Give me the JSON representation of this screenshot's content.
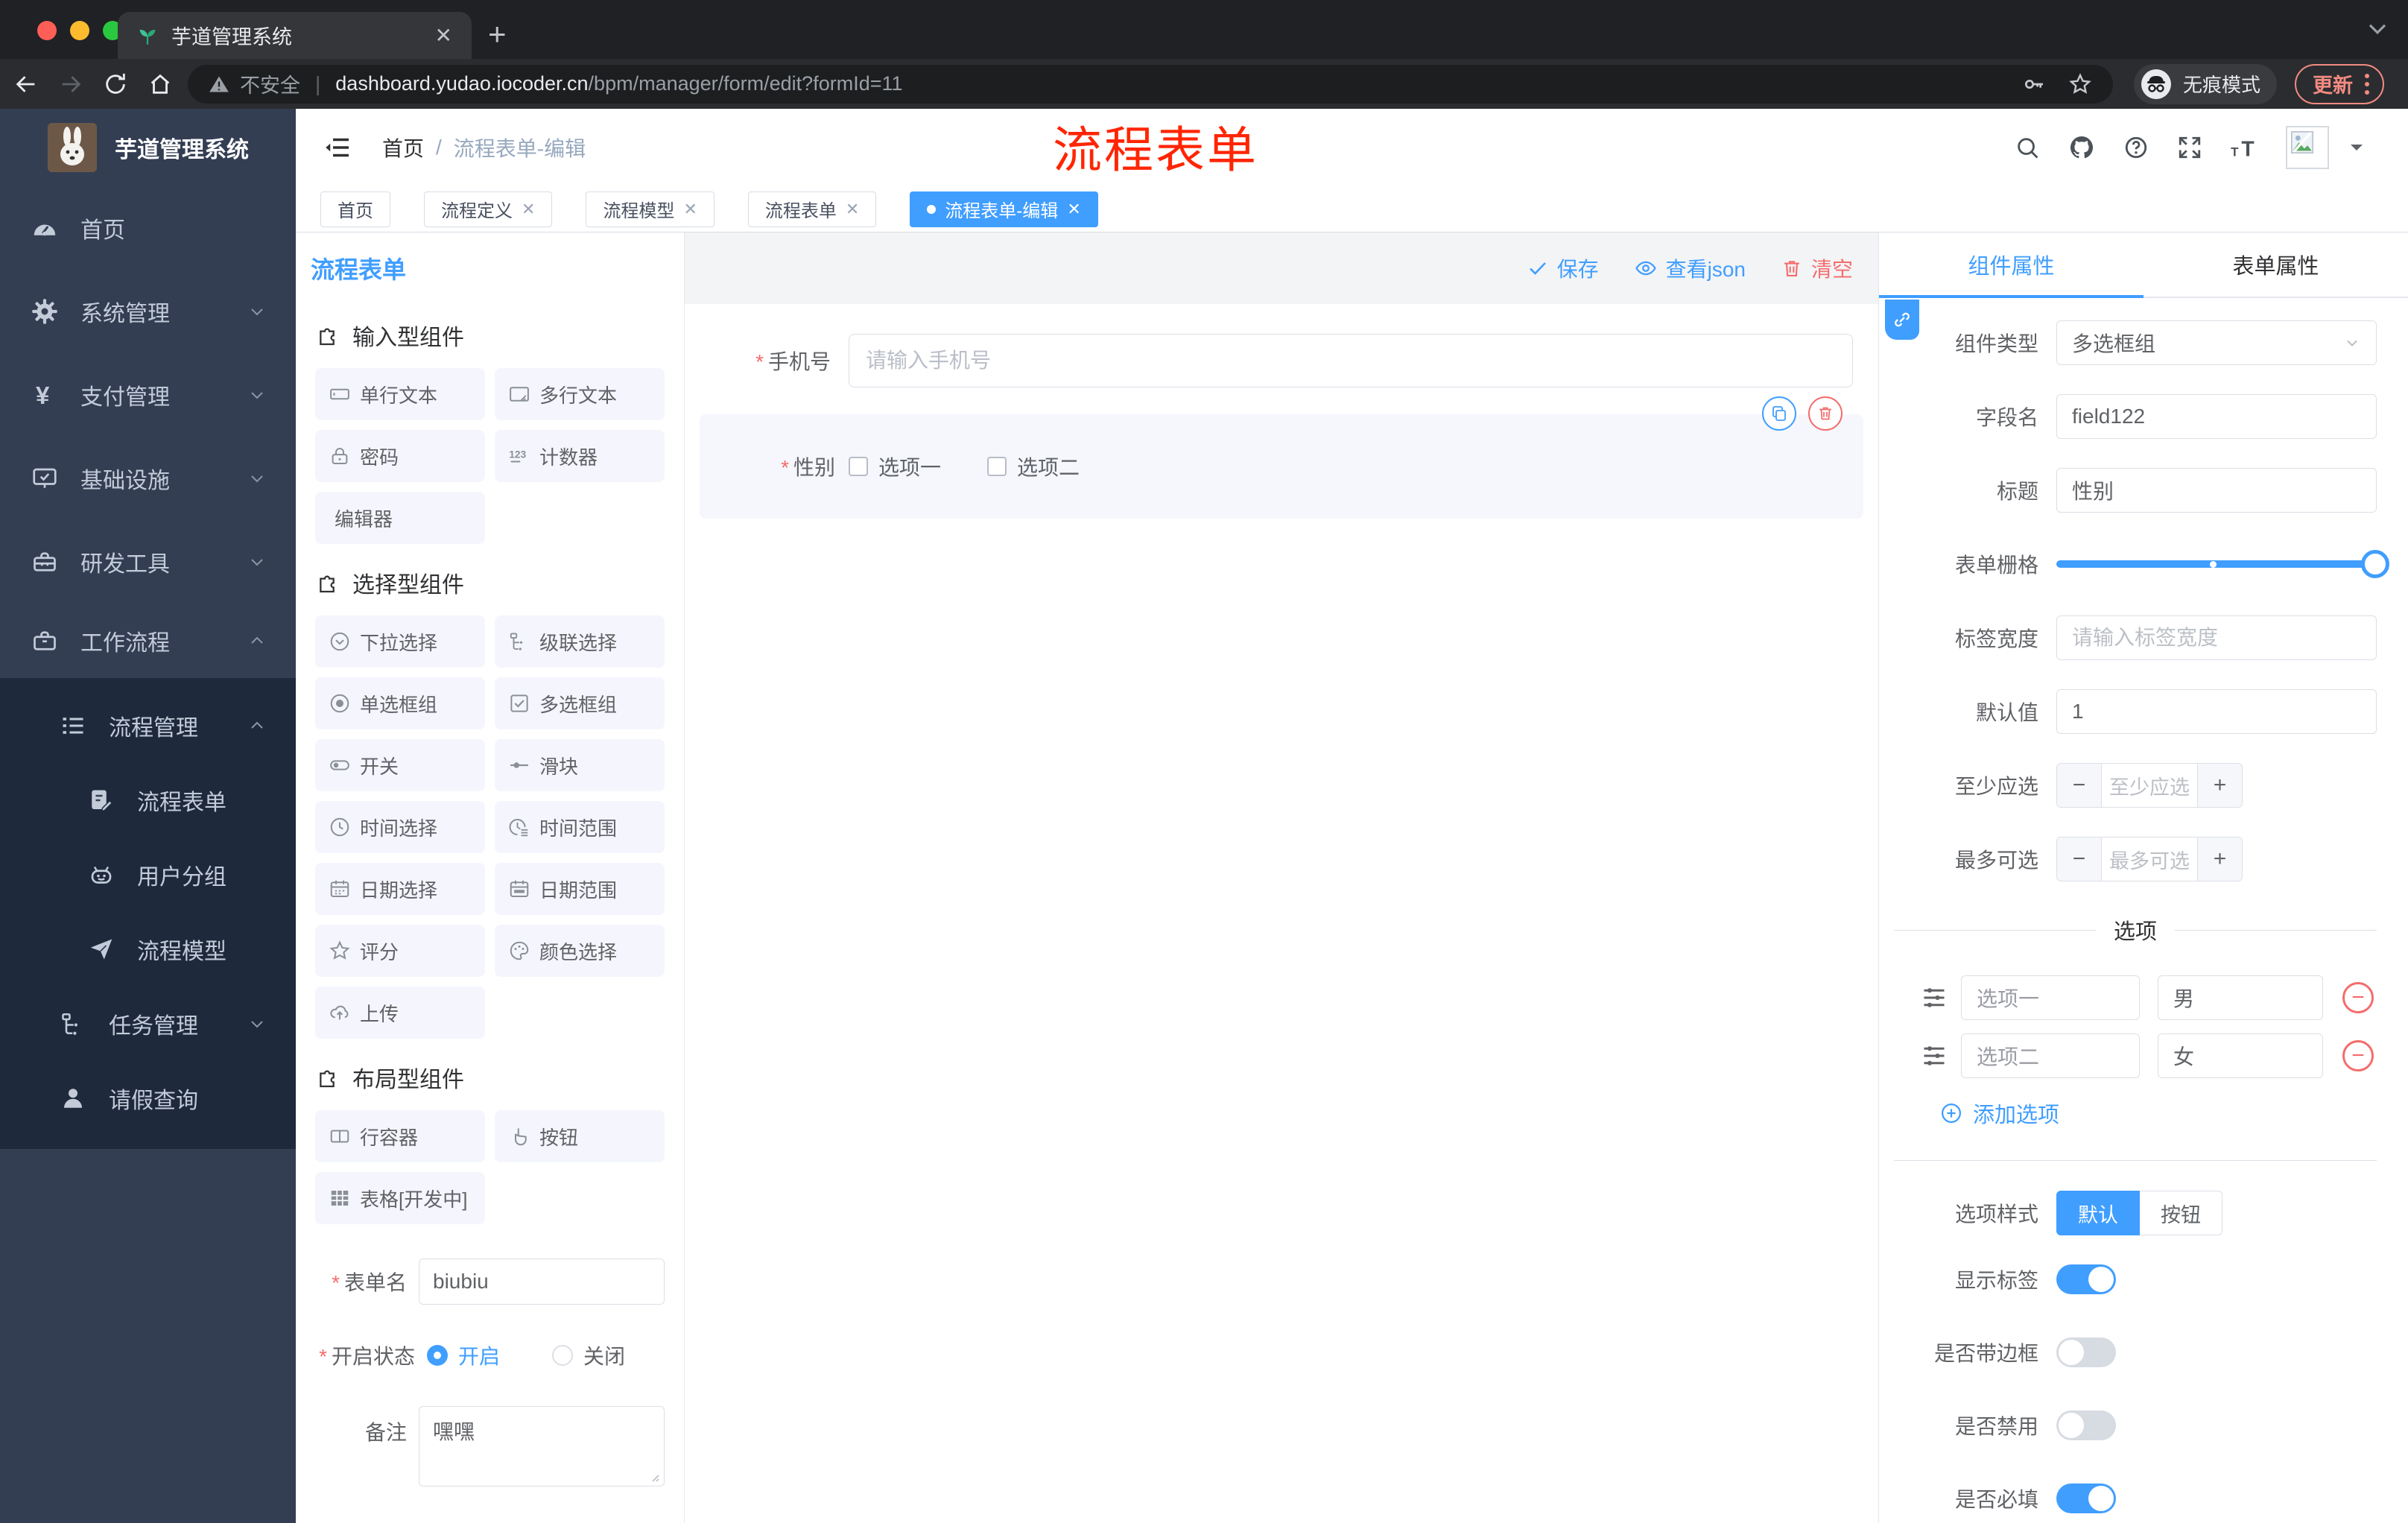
{
  "colors": {
    "accent": "#409eff",
    "danger": "#f56c6c",
    "annotation_red": "#ff2503",
    "sidebar_bg": "#333e53",
    "submenu_bg": "#1e2a3c",
    "chip_bg": "#f5f6fd",
    "selected_block_bg": "#f5f7fd"
  },
  "browser": {
    "tab_title": "芋道管理系统",
    "not_secure": "不安全",
    "url_host": "dashboard.yudao.iocoder.cn",
    "url_path": "/bpm/manager/form/edit?formId=11",
    "incognito": "无痕模式",
    "update": "更新"
  },
  "annotation": {
    "text": "流程表单"
  },
  "sidebar": {
    "logo_title": "芋道管理系统",
    "items": [
      {
        "label": "首页",
        "icon": "gauge-icon"
      },
      {
        "label": "系统管理",
        "icon": "gear-icon",
        "chevron": "down"
      },
      {
        "label": "支付管理",
        "icon": "yen-icon",
        "chevron": "down"
      },
      {
        "label": "基础设施",
        "icon": "monitor-icon",
        "chevron": "down"
      },
      {
        "label": "研发工具",
        "icon": "toolbox-icon",
        "chevron": "down"
      },
      {
        "label": "工作流程",
        "icon": "briefcase-icon",
        "chevron": "up"
      },
      {
        "label": "流程管理",
        "icon": "list-icon",
        "chevron": "up"
      },
      {
        "label": "流程表单",
        "icon": "form-doc-icon"
      },
      {
        "label": "用户分组",
        "icon": "robot-icon"
      },
      {
        "label": "流程模型",
        "icon": "paper-plane-icon"
      },
      {
        "label": "任务管理",
        "icon": "tree-icon",
        "chevron": "down"
      },
      {
        "label": "请假查询",
        "icon": "person-icon"
      }
    ]
  },
  "topbar": {
    "breadcrumb_home": "首页",
    "breadcrumb_sep": "/",
    "breadcrumb_current": "流程表单-编辑"
  },
  "page_tabs": {
    "tabs": [
      {
        "label": "首页"
      },
      {
        "label": "流程定义"
      },
      {
        "label": "流程模型"
      },
      {
        "label": "流程表单"
      },
      {
        "label": "流程表单-编辑"
      }
    ]
  },
  "left_panel": {
    "title": "流程表单",
    "sections": [
      {
        "title": "输入型组件",
        "items": [
          {
            "label": "单行文本",
            "icon": "input-icon"
          },
          {
            "label": "多行文本",
            "icon": "textarea-icon"
          },
          {
            "label": "密码",
            "icon": "lock-icon"
          },
          {
            "label": "计数器",
            "icon": "counter-icon"
          },
          {
            "label": "编辑器",
            "icon": "none"
          }
        ]
      },
      {
        "title": "选择型组件",
        "items": [
          {
            "label": "下拉选择",
            "icon": "select-icon"
          },
          {
            "label": "级联选择",
            "icon": "cascade-icon"
          },
          {
            "label": "单选框组",
            "icon": "radio-icon"
          },
          {
            "label": "多选框组",
            "icon": "checkbox-icon"
          },
          {
            "label": "开关",
            "icon": "switch-icon"
          },
          {
            "label": "滑块",
            "icon": "slider-icon"
          },
          {
            "label": "时间选择",
            "icon": "time-icon"
          },
          {
            "label": "时间范围",
            "icon": "time-range-icon"
          },
          {
            "label": "日期选择",
            "icon": "date-icon"
          },
          {
            "label": "日期范围",
            "icon": "date-range-icon"
          },
          {
            "label": "评分",
            "icon": "star-icon"
          },
          {
            "label": "颜色选择",
            "icon": "palette-icon"
          },
          {
            "label": "上传",
            "icon": "upload-icon"
          }
        ]
      },
      {
        "title": "布局型组件",
        "items": [
          {
            "label": "行容器",
            "icon": "row-container-icon"
          },
          {
            "label": "按钮",
            "icon": "button-icon"
          },
          {
            "label": "表格[开发中]",
            "icon": "table-icon"
          }
        ]
      }
    ],
    "form": {
      "name_label": "表单名",
      "name_value": "biubiu",
      "status_label": "开启状态",
      "status_on": "开启",
      "status_off": "关闭",
      "status_value": "开启",
      "remark_label": "备注",
      "remark_value": "嘿嘿"
    }
  },
  "canvas": {
    "save": "保存",
    "view_json": "查看json",
    "clear": "清空",
    "phone": {
      "label": "手机号",
      "placeholder": "请输入手机号"
    },
    "gender": {
      "label": "性别",
      "option1": "选项一",
      "option2": "选项二"
    }
  },
  "inspector": {
    "tab_component": "组件属性",
    "tab_form": "表单属性",
    "component_type_label": "组件类型",
    "component_type_value": "多选框组",
    "field_name_label": "字段名",
    "field_name_value": "field122",
    "title_label": "标题",
    "title_value": "性别",
    "grid_label": "表单栅格",
    "label_width_label": "标签宽度",
    "label_width_placeholder": "请输入标签宽度",
    "default_label": "默认值",
    "default_value": "1",
    "min_label": "至少应选",
    "min_placeholder": "至少应选",
    "max_label": "最多可选",
    "max_placeholder": "最多可选",
    "options_title": "选项",
    "options": [
      {
        "label": "选项一",
        "value": "男"
      },
      {
        "label": "选项二",
        "value": "女"
      }
    ],
    "add_option": "添加选项",
    "style_label": "选项样式",
    "style_default": "默认",
    "style_button": "按钮",
    "toggle_show_label": "显示标签",
    "toggle_border": "是否带边框",
    "toggle_disabled": "是否禁用",
    "toggle_required": "是否必填"
  }
}
